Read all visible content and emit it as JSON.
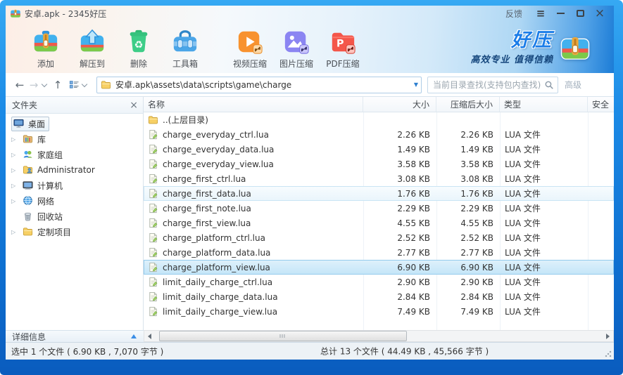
{
  "window": {
    "title": "安卓.apk - 2345好压",
    "feedback_label": "反馈"
  },
  "toolbar": {
    "buttons": [
      {
        "id": "add",
        "label": "添加",
        "icon": "archive-add-icon"
      },
      {
        "id": "extract-to",
        "label": "解压到",
        "icon": "extract-icon"
      },
      {
        "id": "delete",
        "label": "删除",
        "icon": "delete-icon"
      },
      {
        "id": "toolbox",
        "label": "工具箱",
        "icon": "toolbox-icon"
      },
      {
        "id": "video-compress",
        "label": "视频压缩",
        "icon": "video-compress-icon",
        "group": 2
      },
      {
        "id": "image-compress",
        "label": "图片压缩",
        "icon": "image-compress-icon",
        "group": 2
      },
      {
        "id": "pdf-compress",
        "label": "PDF压缩",
        "icon": "pdf-compress-icon",
        "group": 2
      }
    ],
    "brand": {
      "name": "好压",
      "slogan": "高效专业 值得信赖"
    }
  },
  "navbar": {
    "path": "安卓.apk\\assets\\data\\scripts\\game\\charge",
    "search_placeholder": "当前目录查找(支持包内查找)",
    "advanced_label": "高级"
  },
  "sidebar": {
    "title": "文件夹",
    "details_label": "详细信息",
    "items": [
      {
        "id": "desktop",
        "label": "桌面",
        "icon": "desktop-icon",
        "root": true,
        "selected": true,
        "expandable": false
      },
      {
        "id": "libraries",
        "label": "库",
        "icon": "library-icon",
        "expandable": true
      },
      {
        "id": "homegroup",
        "label": "家庭组",
        "icon": "homegroup-icon",
        "expandable": true
      },
      {
        "id": "administrator",
        "label": "Administrator",
        "icon": "user-folder-icon",
        "expandable": true
      },
      {
        "id": "computer",
        "label": "计算机",
        "icon": "computer-icon",
        "expandable": true
      },
      {
        "id": "network",
        "label": "网络",
        "icon": "network-icon",
        "expandable": true
      },
      {
        "id": "recycle-bin",
        "label": "回收站",
        "icon": "recycle-bin-icon",
        "expandable": false
      },
      {
        "id": "custom-items",
        "label": "定制项目",
        "icon": "folder-icon",
        "expandable": true
      }
    ]
  },
  "filelist": {
    "columns": [
      "名称",
      "大小",
      "压缩后大小",
      "类型",
      "安全"
    ],
    "parent_row": {
      "name": "..(上层目录)"
    },
    "rows": [
      {
        "name": "charge_everyday_ctrl.lua",
        "size": "2.26 KB",
        "packed": "2.26 KB",
        "type": "LUA 文件",
        "state": "normal"
      },
      {
        "name": "charge_everyday_data.lua",
        "size": "1.49 KB",
        "packed": "1.49 KB",
        "type": "LUA 文件",
        "state": "normal"
      },
      {
        "name": "charge_everyday_view.lua",
        "size": "3.58 KB",
        "packed": "3.58 KB",
        "type": "LUA 文件",
        "state": "normal"
      },
      {
        "name": "charge_first_ctrl.lua",
        "size": "3.08 KB",
        "packed": "3.08 KB",
        "type": "LUA 文件",
        "state": "normal"
      },
      {
        "name": "charge_first_data.lua",
        "size": "1.76 KB",
        "packed": "1.76 KB",
        "type": "LUA 文件",
        "state": "hover"
      },
      {
        "name": "charge_first_note.lua",
        "size": "2.29 KB",
        "packed": "2.29 KB",
        "type": "LUA 文件",
        "state": "normal"
      },
      {
        "name": "charge_first_view.lua",
        "size": "4.55 KB",
        "packed": "4.55 KB",
        "type": "LUA 文件",
        "state": "normal"
      },
      {
        "name": "charge_platform_ctrl.lua",
        "size": "2.52 KB",
        "packed": "2.52 KB",
        "type": "LUA 文件",
        "state": "normal"
      },
      {
        "name": "charge_platform_data.lua",
        "size": "2.77 KB",
        "packed": "2.77 KB",
        "type": "LUA 文件",
        "state": "normal"
      },
      {
        "name": "charge_platform_view.lua",
        "size": "6.90 KB",
        "packed": "6.90 KB",
        "type": "LUA 文件",
        "state": "selected"
      },
      {
        "name": "limit_daily_charge_ctrl.lua",
        "size": "2.90 KB",
        "packed": "2.90 KB",
        "type": "LUA 文件",
        "state": "normal"
      },
      {
        "name": "limit_daily_charge_data.lua",
        "size": "2.84 KB",
        "packed": "2.84 KB",
        "type": "LUA 文件",
        "state": "normal"
      },
      {
        "name": "limit_daily_charge_view.lua",
        "size": "7.49 KB",
        "packed": "7.49 KB",
        "type": "LUA 文件",
        "state": "normal"
      }
    ]
  },
  "statusbar": {
    "selected_info": "选中 1 个文件 ( 6.90 KB , 7,070 字节 )",
    "total_info": "总计 13 个文件 ( 44.49 KB , 45,566 字节 )"
  }
}
